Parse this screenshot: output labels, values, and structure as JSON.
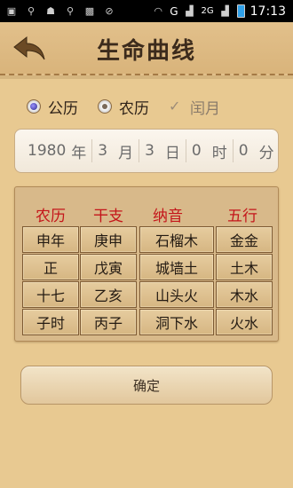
{
  "statusbar": {
    "time": "17:13",
    "network": "G",
    "network2": "2G",
    "left_icons": [
      "app-icon",
      "usb-icon",
      "android-icon",
      "usb-icon",
      "sim-off-icon",
      "mute-icon"
    ],
    "right_icons": [
      "wifi-icon",
      "signal-icon",
      "signal-icon",
      "battery-icon"
    ]
  },
  "header": {
    "title": "生命曲线",
    "back_icon": "back-arrow-icon"
  },
  "calendar_type": {
    "solar_label": "公历",
    "lunar_label": "农历",
    "leap_label": "闰月",
    "selected": "solar",
    "leap_checked": true,
    "leap_enabled": false
  },
  "date": {
    "year": "1980",
    "year_unit": "年",
    "month": "3",
    "month_unit": "月",
    "day": "3",
    "day_unit": "日",
    "hour": "0",
    "hour_unit": "时",
    "minute": "0",
    "minute_unit": "分"
  },
  "table": {
    "headers": [
      "农历",
      "干支",
      "纳音",
      "五行"
    ],
    "rows": [
      [
        "申年",
        "庚申",
        "石榴木",
        "金金"
      ],
      [
        "正",
        "戊寅",
        "城墙土",
        "土木"
      ],
      [
        "十七",
        "乙亥",
        "山头火",
        "木水"
      ],
      [
        "子时",
        "丙子",
        "洞下水",
        "火水"
      ]
    ]
  },
  "confirm_label": "确定",
  "colors": {
    "header_red": "#c4151a",
    "background": "#e8c991",
    "title": "#3c2b1c"
  }
}
